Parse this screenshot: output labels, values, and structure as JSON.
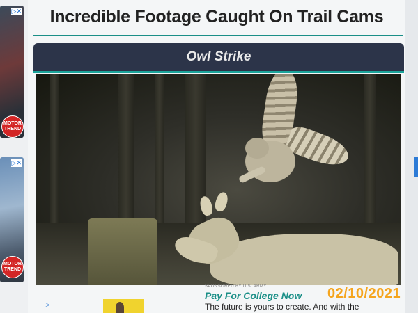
{
  "page": {
    "title": "Incredible Footage Caught On Trail Cams"
  },
  "card": {
    "title": "Owl Strike"
  },
  "side_ads": {
    "brand": "MOTOR TREND",
    "ad_marker": "▷✕"
  },
  "sponsored": {
    "label": "SPONSORED BY U.S. ARMY",
    "headline": "Pay For College Now",
    "body": "The future is yours to create. And with the"
  },
  "overlay": {
    "date": "02/10/2021"
  },
  "colors": {
    "accent_teal": "#1a8f87",
    "header_navy": "#2c3449",
    "date_orange": "#f5a51e"
  }
}
